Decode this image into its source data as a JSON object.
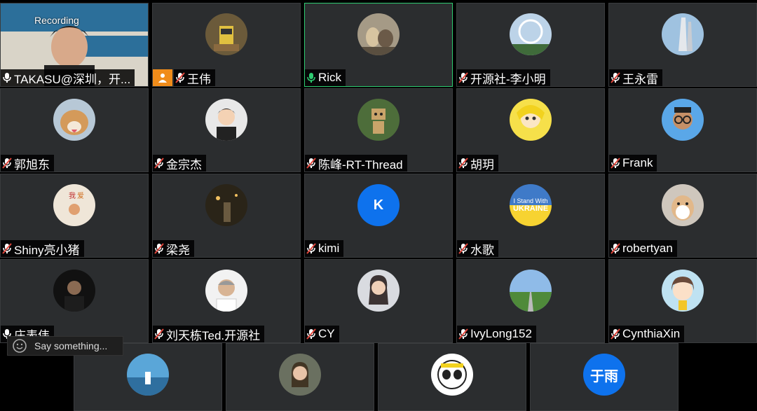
{
  "recording_label": "Recording",
  "chat": {
    "placeholder": "Say something..."
  },
  "participants": [
    {
      "name": "TAKASU@深圳，开...",
      "mic": "on",
      "avatar": "video"
    },
    {
      "name": "王伟",
      "mic": "muted",
      "avatar": "robot-photo",
      "host": true
    },
    {
      "name": "Rick",
      "mic": "on",
      "avatar": "dogs-photo",
      "speaking": true
    },
    {
      "name": "开源社-李小明",
      "mic": "muted",
      "avatar": "ferris-wheel-photo"
    },
    {
      "name": "王永雷",
      "mic": "muted",
      "avatar": "tower-photo"
    },
    {
      "name": "郭旭东",
      "mic": "muted",
      "avatar": "shiba-photo"
    },
    {
      "name": "金宗杰",
      "mic": "muted",
      "avatar": "cartoon-man"
    },
    {
      "name": "陈峰-RT-Thread",
      "mic": "muted",
      "avatar": "cardboard-robot-photo"
    },
    {
      "name": "胡玥",
      "mic": "muted",
      "avatar": "anime-girl"
    },
    {
      "name": "Frank",
      "mic": "muted",
      "avatar": "cartoon-glasses"
    },
    {
      "name": "Shiny亮小猪",
      "mic": "muted",
      "avatar": "kids-drawing"
    },
    {
      "name": "梁尧",
      "mic": "muted",
      "avatar": "night-photo"
    },
    {
      "name": "kimi",
      "mic": "muted",
      "avatar": "letter",
      "letter": "K"
    },
    {
      "name": "水歌",
      "mic": "muted",
      "avatar": "ukraine",
      "badge_lines": [
        "I Stand With",
        "UKRAINE"
      ]
    },
    {
      "name": "robertyan",
      "mic": "muted",
      "avatar": "hamster"
    },
    {
      "name": "庄表伟",
      "mic": "on",
      "avatar": "man-dark-photo"
    },
    {
      "name": "刘天栋Ted.开源社",
      "mic": "muted",
      "avatar": "man-white-photo"
    },
    {
      "name": "CY",
      "mic": "muted",
      "avatar": "woman-photo"
    },
    {
      "name": "IvyLong152",
      "mic": "muted",
      "avatar": "road-photo"
    },
    {
      "name": "CynthiaXin",
      "mic": "muted",
      "avatar": "cartoon-girl"
    },
    {
      "name": "",
      "mic": "none",
      "avatar": "sea-photo"
    },
    {
      "name": "",
      "mic": "none",
      "avatar": "girl-photo"
    },
    {
      "name": "",
      "mic": "none",
      "avatar": "panda"
    },
    {
      "name": "",
      "mic": "none",
      "avatar": "letter",
      "letter": "于雨"
    }
  ],
  "colors": {
    "tile_bg": "#2b2d2f",
    "speaking_border": "#2ecc71",
    "letter_avatar": "#0e72ed",
    "host_badge": "#f08c1a",
    "mic_muted": "#e0453b",
    "mic_on": "#ffffff",
    "mic_active": "#2ecc71"
  }
}
